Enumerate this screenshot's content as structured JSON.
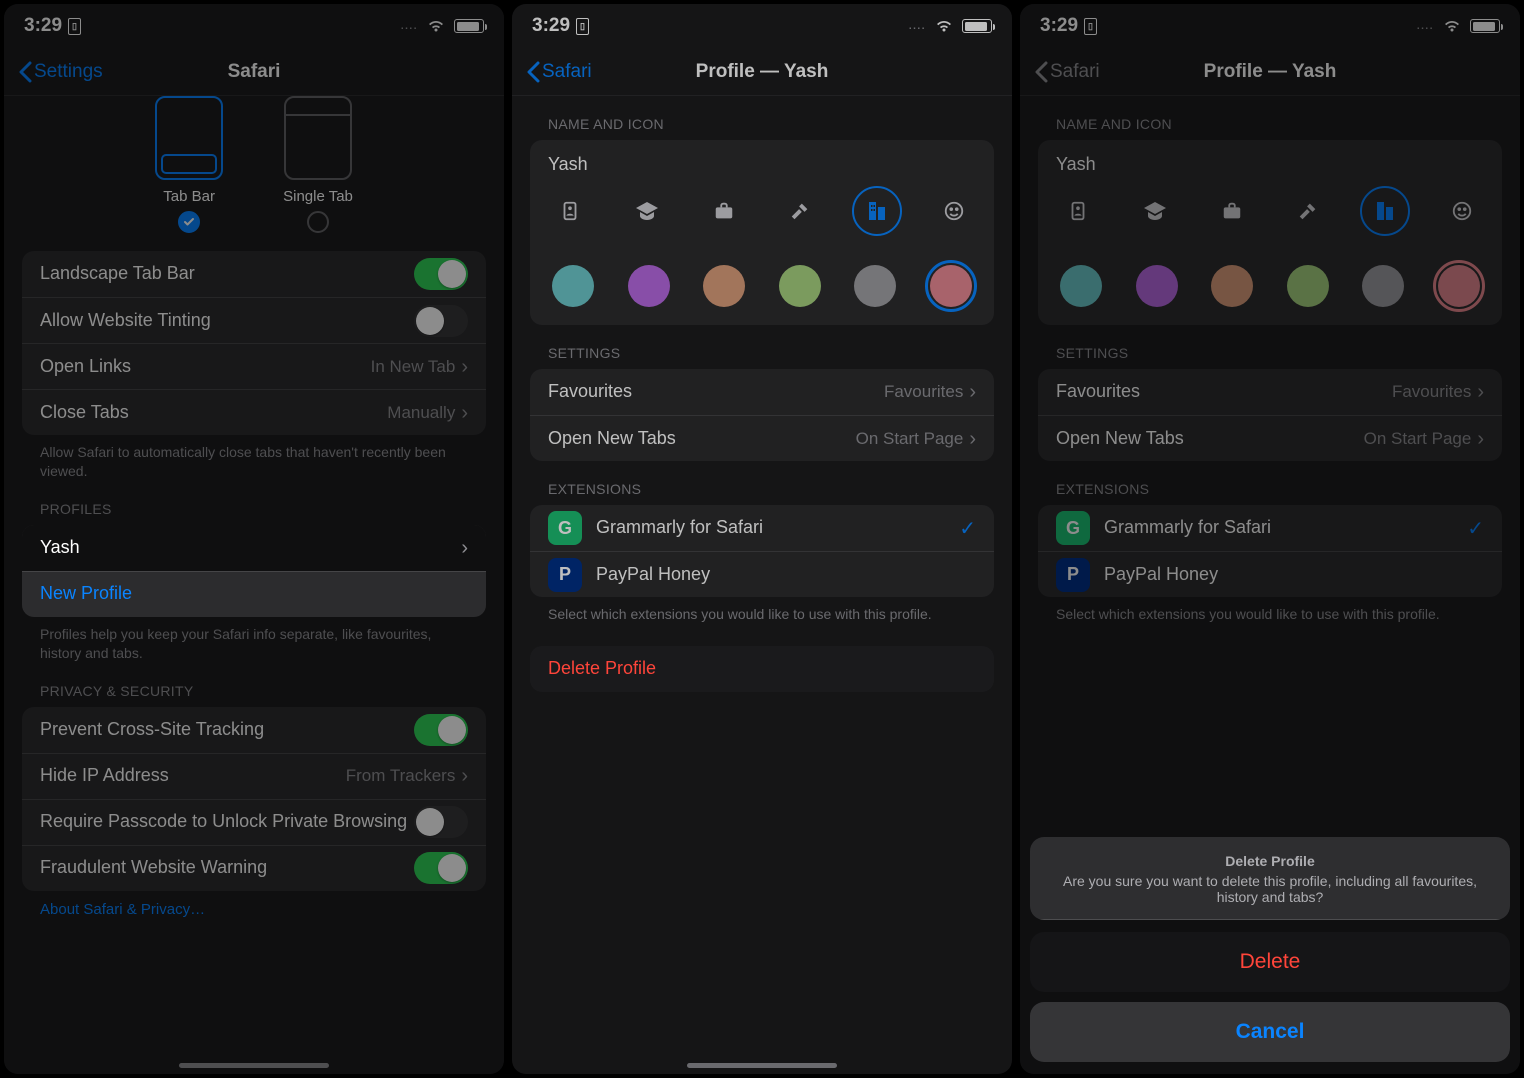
{
  "status": {
    "time": "3:29",
    "dots": "...."
  },
  "screen1": {
    "back": "Settings",
    "title": "Safari",
    "tab_layout": {
      "opt1": "Tab Bar",
      "opt2": "Single Tab"
    },
    "rows": {
      "landscape": "Landscape Tab Bar",
      "tinting": "Allow Website Tinting",
      "open_links": "Open Links",
      "open_links_val": "In New Tab",
      "close_tabs": "Close Tabs",
      "close_tabs_val": "Manually"
    },
    "close_note": "Allow Safari to automatically close tabs that haven't recently been viewed.",
    "profiles_label": "PROFILES",
    "profile_name": "Yash",
    "new_profile": "New Profile",
    "profiles_note": "Profiles help you keep your Safari info separate, like favourites, history and tabs.",
    "privacy_label": "PRIVACY & SECURITY",
    "privacy": {
      "tracking": "Prevent Cross-Site Tracking",
      "hide_ip": "Hide IP Address",
      "hide_ip_val": "From Trackers",
      "passcode": "Require Passcode to Unlock Private Browsing",
      "fraud": "Fraudulent Website Warning"
    },
    "about_link": "About Safari & Privacy…"
  },
  "screen2": {
    "back": "Safari",
    "title": "Profile — Yash",
    "label_nameicon": "NAME AND ICON",
    "name_value": "Yash",
    "label_settings": "SETTINGS",
    "favourites": "Favourites",
    "favourites_val": "Favourites",
    "newtabs": "Open New Tabs",
    "newtabs_val": "On Start Page",
    "label_ext": "EXTENSIONS",
    "ext1": "Grammarly for Safari",
    "ext2": "PayPal Honey",
    "ext_note": "Select which extensions you would like to use with this profile.",
    "delete": "Delete Profile",
    "colors": [
      "#6bc6c9",
      "#b668e0",
      "#d99c7a",
      "#a4cf7e",
      "#9c9ca1",
      "#e0858f"
    ],
    "icons": [
      "id",
      "grad",
      "briefcase",
      "hammer",
      "building",
      "smile"
    ]
  },
  "sheet": {
    "title": "Delete Profile",
    "msg": "Are you sure you want to delete this profile, including all favourites, history and tabs?",
    "delete": "Delete",
    "cancel": "Cancel"
  }
}
